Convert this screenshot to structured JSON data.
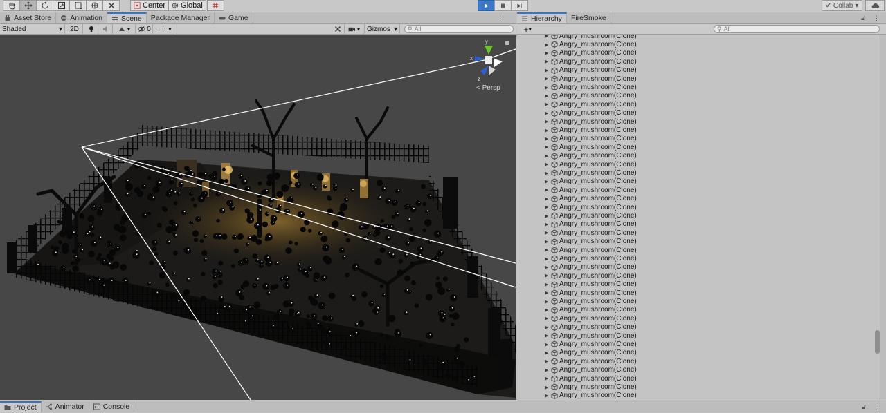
{
  "toolbar": {
    "pivot_label": "Center",
    "space_label": "Global",
    "collab_label": "Collab",
    "colors": {
      "play_active": "#3b78c9"
    }
  },
  "scene_tabs": [
    {
      "label": "Asset Store",
      "icon": "shopping-bag-icon"
    },
    {
      "label": "Animation",
      "icon": "animation-icon"
    },
    {
      "label": "Scene",
      "icon": "grid-icon",
      "active": true
    },
    {
      "label": "Package Manager",
      "icon": ""
    },
    {
      "label": "Game",
      "icon": "gamepad-icon"
    }
  ],
  "scene_toolbar": {
    "draw_mode": "Shaded",
    "mode_2d": "2D",
    "hidden_count": "0",
    "gizmos_label": "Gizmos",
    "search_placeholder": "All"
  },
  "scene_view": {
    "persp_label": "Persp",
    "axis_labels": {
      "x": "x",
      "y": "y",
      "z": "z"
    }
  },
  "hierarchy": {
    "tabs": [
      {
        "label": "Hierarchy",
        "icon": "list-icon",
        "active": true
      },
      {
        "label": "FireSmoke",
        "icon": ""
      }
    ],
    "search_placeholder": "All",
    "items": [
      "Angry_mushroom(Clone)",
      "Angry_mushroom(Clone)",
      "Angry_mushroom(Clone)",
      "Angry_mushroom(Clone)",
      "Angry_mushroom(Clone)",
      "Angry_mushroom(Clone)",
      "Angry_mushroom(Clone)",
      "Angry_mushroom(Clone)",
      "Angry_mushroom(Clone)",
      "Angry_mushroom(Clone)",
      "Angry_mushroom(Clone)",
      "Angry_mushroom(Clone)",
      "Angry_mushroom(Clone)",
      "Angry_mushroom(Clone)",
      "Angry_mushroom(Clone)",
      "Angry_mushroom(Clone)",
      "Angry_mushroom(Clone)",
      "Angry_mushroom(Clone)",
      "Angry_mushroom(Clone)",
      "Angry_mushroom(Clone)",
      "Angry_mushroom(Clone)",
      "Angry_mushroom(Clone)",
      "Angry_mushroom(Clone)",
      "Angry_mushroom(Clone)",
      "Angry_mushroom(Clone)",
      "Angry_mushroom(Clone)",
      "Angry_mushroom(Clone)",
      "Angry_mushroom(Clone)",
      "Angry_mushroom(Clone)",
      "Angry_mushroom(Clone)",
      "Angry_mushroom(Clone)",
      "Angry_mushroom(Clone)",
      "Angry_mushroom(Clone)",
      "Angry_mushroom(Clone)",
      "Angry_mushroom(Clone)",
      "Angry_mushroom(Clone)",
      "Angry_mushroom(Clone)",
      "Angry_mushroom(Clone)",
      "Angry_mushroom(Clone)",
      "Angry_mushroom(Clone)",
      "Angry_mushroom(Clone)",
      "Angry_mushroom(Clone)",
      "Angry_mushroom(Clone)",
      "Angry_mushroom(Clone)"
    ]
  },
  "bottom_tabs": [
    {
      "label": "Project",
      "icon": "folder-icon",
      "active": true
    },
    {
      "label": "Animator",
      "icon": "animator-icon"
    },
    {
      "label": "Console",
      "icon": "console-icon"
    }
  ]
}
